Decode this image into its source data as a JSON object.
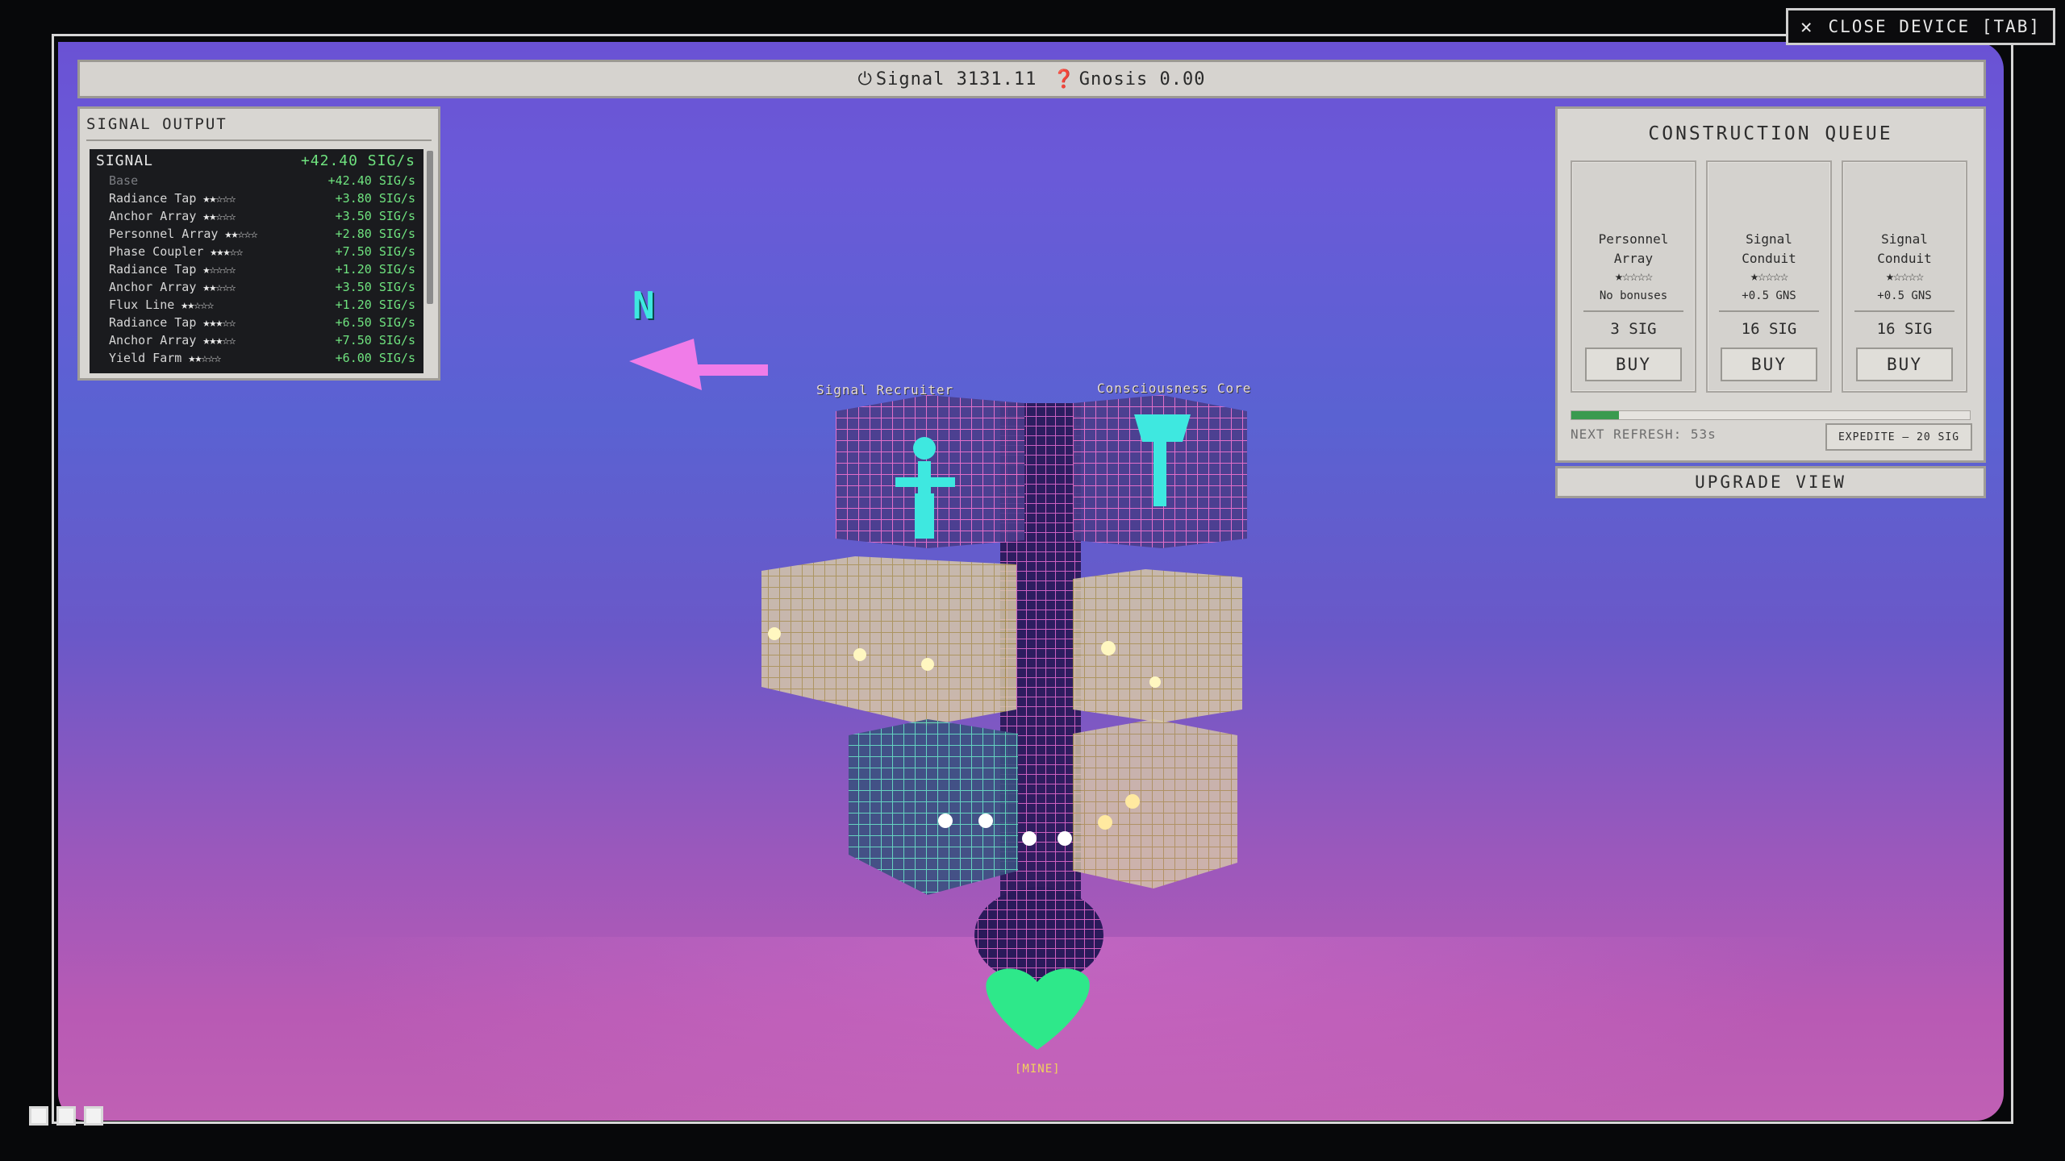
{
  "close_device": {
    "icon": "close-icon",
    "label": "CLOSE DEVICE [TAB]"
  },
  "topbar": {
    "signal_icon": "power-icon",
    "signal_label": "Signal 3131.11",
    "gnosis_icon": "question-icon",
    "gnosis_label": "Gnosis 0.00"
  },
  "signal_output": {
    "title": "SIGNAL OUTPUT",
    "header": {
      "label": "SIGNAL",
      "value": "+42.40 SIG/s"
    },
    "rows": [
      {
        "name": "Base",
        "stars": "",
        "value": "+42.40 SIG/s"
      },
      {
        "name": "Radiance Tap",
        "stars": "★★☆☆☆",
        "value": "+3.80 SIG/s"
      },
      {
        "name": "Anchor Array",
        "stars": "★★☆☆☆",
        "value": "+3.50 SIG/s"
      },
      {
        "name": "Personnel Array",
        "stars": "★★☆☆☆",
        "value": "+2.80 SIG/s"
      },
      {
        "name": "Phase Coupler",
        "stars": "★★★☆☆",
        "value": "+7.50 SIG/s"
      },
      {
        "name": "Radiance Tap",
        "stars": "★☆☆☆☆",
        "value": "+1.20 SIG/s"
      },
      {
        "name": "Anchor Array",
        "stars": "★★☆☆☆",
        "value": "+3.50 SIG/s"
      },
      {
        "name": "Flux Line",
        "stars": "★★☆☆☆",
        "value": "+1.20 SIG/s"
      },
      {
        "name": "Radiance Tap",
        "stars": "★★★☆☆",
        "value": "+6.50 SIG/s"
      },
      {
        "name": "Anchor Array",
        "stars": "★★★☆☆",
        "value": "+7.50 SIG/s"
      },
      {
        "name": "Yield Farm",
        "stars": "★★☆☆☆",
        "value": "+6.00 SIG/s"
      }
    ]
  },
  "construction_queue": {
    "title": "CONSTRUCTION QUEUE",
    "cards": [
      {
        "name_1": "Personnel",
        "name_2": "Array",
        "stars": "★☆☆☆☆",
        "bonus": "No bonuses",
        "price": "3 SIG",
        "buy": "BUY"
      },
      {
        "name_1": "Signal",
        "name_2": "Conduit",
        "stars": "★☆☆☆☆",
        "bonus": "+0.5 GNS",
        "price": "16 SIG",
        "buy": "BUY"
      },
      {
        "name_1": "Signal",
        "name_2": "Conduit",
        "stars": "★☆☆☆☆",
        "bonus": "+0.5 GNS",
        "price": "16 SIG",
        "buy": "BUY"
      }
    ],
    "refresh_progress": 0.12,
    "next_refresh": "NEXT REFRESH: 53s",
    "expedite": "EXPEDITE — 20 SIG"
  },
  "upgrade_view": "UPGRADE VIEW",
  "scene": {
    "compass": "N",
    "labels": {
      "signal_recruiter": "Signal Recruiter",
      "consciousness_core": "Consciousness Core",
      "mine": "[MINE]"
    },
    "colors": {
      "sky_top": "#6a52d4",
      "sky_bottom": "#c060b4",
      "arrow": "#f07ce8",
      "cyan": "#3ee8e0",
      "heart": "#2ee88a"
    }
  }
}
